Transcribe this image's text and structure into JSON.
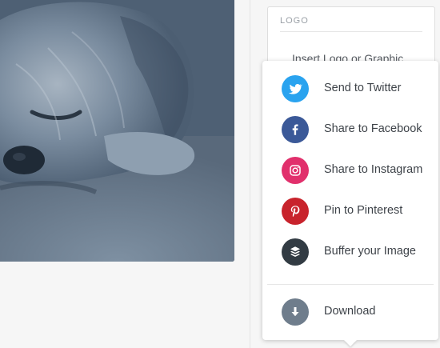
{
  "logo_panel": {
    "title": "LOGO",
    "insert_label": "Insert Logo or Graphic"
  },
  "share_menu": {
    "items": [
      {
        "label": "Send to Twitter",
        "icon": "twitter-icon",
        "color": "#2aa3ef"
      },
      {
        "label": "Share to Facebook",
        "icon": "facebook-icon",
        "color": "#3b5998"
      },
      {
        "label": "Share to Instagram",
        "icon": "instagram-icon",
        "color": "#e1306c"
      },
      {
        "label": "Pin to Pinterest",
        "icon": "pinterest-icon",
        "color": "#c8232c"
      },
      {
        "label": "Buffer your Image",
        "icon": "buffer-icon",
        "color": "#323b43"
      }
    ],
    "download": {
      "label": "Download",
      "icon": "download-arrow-icon",
      "color": "#6f7d8c"
    }
  },
  "photo": {
    "icon": "dog-photo",
    "overlay_color": "#55687d"
  }
}
